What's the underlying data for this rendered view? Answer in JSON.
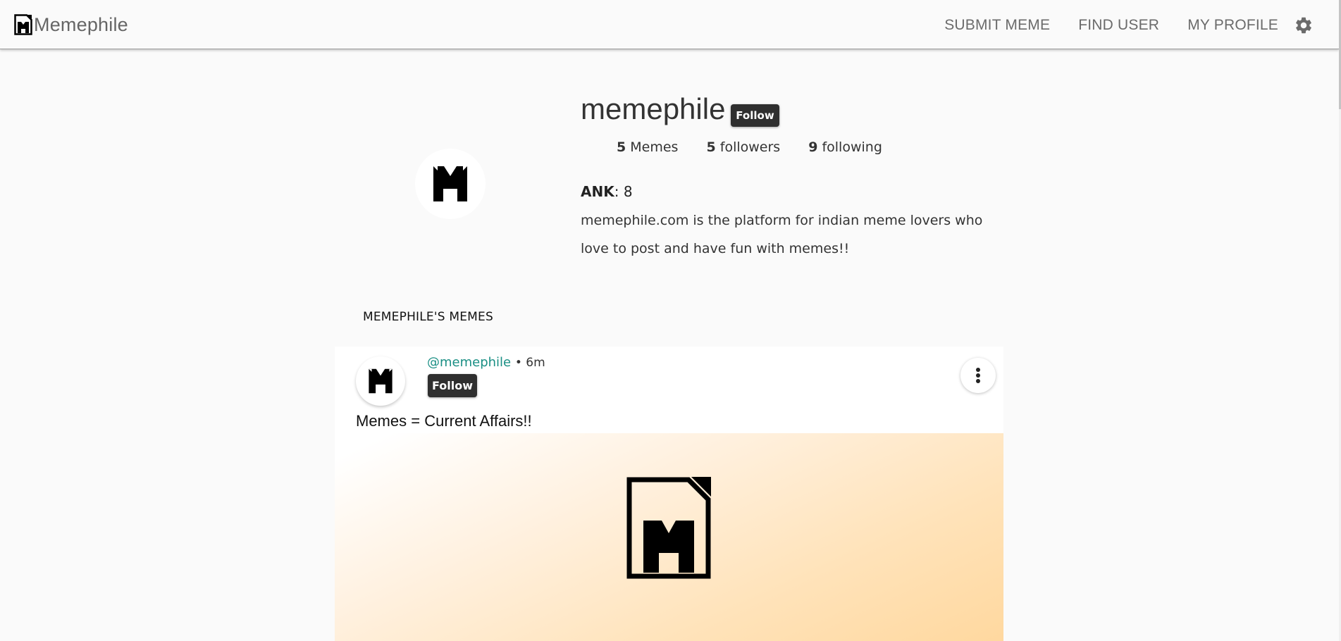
{
  "nav": {
    "brand": "Memephile",
    "links": [
      "SUBMIT MEME",
      "FIND USER",
      "MY PROFILE"
    ],
    "settings_icon": "gear-icon"
  },
  "profile": {
    "username": "memephile",
    "follow_label": "Follow",
    "stats": {
      "memes_count": "5",
      "memes_label": "Memes",
      "followers_count": "5",
      "followers_label": "followers",
      "following_count": "9",
      "following_label": "following"
    },
    "rank_label": "ANK",
    "rank_sep": ": ",
    "rank_value": "8",
    "bio": "memephile.com is the platform for indian meme lovers who love to post and have fun with memes!!"
  },
  "memes_section": {
    "title": "MEMEPHILE'S MEMES",
    "posts": [
      {
        "handle": "@memephile",
        "time": "• 6m",
        "follow_label": "Follow",
        "title": "Memes = Current Affairs!!"
      }
    ]
  },
  "colors": {
    "accent_handle": "#1a8f84",
    "button_dark": "#2f2f2f",
    "page_bg": "#fafafa"
  }
}
